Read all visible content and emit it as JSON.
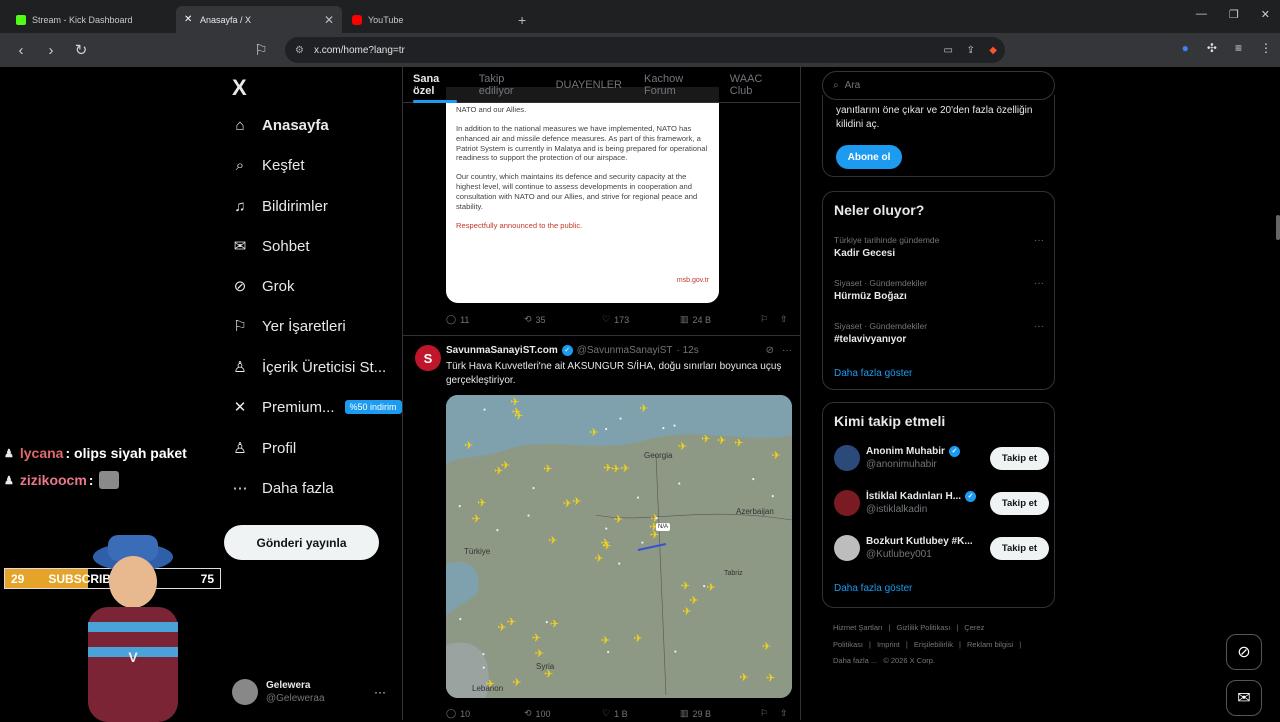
{
  "browser": {
    "tabs": [
      {
        "title": "Stream - Kick Dashboard",
        "favicon_color": "#53fc18"
      },
      {
        "title": "Anasayfa / X",
        "favicon_color": "#ffffff"
      },
      {
        "title": "YouTube",
        "favicon_color": "#ff0000"
      }
    ],
    "new_tab": "+",
    "url": "x.com/home?lang=tr"
  },
  "stream_overlay": {
    "chat": [
      {
        "user": "lycana",
        "user_color": "#e06a6a",
        "message": ": olips siyah paket"
      },
      {
        "user": "zizikoocm",
        "user_color": "#e8788a",
        "message": ":"
      }
    ],
    "subscribers": {
      "current": "29",
      "label": "SUBSCRIBERS",
      "goal": "75",
      "progress": 0.387
    }
  },
  "sidebar": {
    "logo": "X",
    "items": [
      {
        "label": "Anasayfa",
        "icon": "home-icon",
        "glyph": "⌂"
      },
      {
        "label": "Keşfet",
        "icon": "search-icon",
        "glyph": "⌕"
      },
      {
        "label": "Bildirimler",
        "icon": "bell-icon",
        "glyph": "♫"
      },
      {
        "label": "Sohbet",
        "icon": "mail-icon",
        "glyph": "✉"
      },
      {
        "label": "Grok",
        "icon": "grok-icon",
        "glyph": "⊘"
      },
      {
        "label": "Yer İşaretleri",
        "icon": "bookmark-icon",
        "glyph": "⚐"
      },
      {
        "label": "İçerik Üreticisi St...",
        "icon": "creator-icon",
        "glyph": "♙"
      },
      {
        "label": "Premium...",
        "icon": "x-icon",
        "glyph": "✕",
        "badge": "%50 indirim"
      },
      {
        "label": "Profil",
        "icon": "profile-icon",
        "glyph": "♙"
      },
      {
        "label": "Daha fazla",
        "icon": "more-icon",
        "glyph": "⋯"
      }
    ],
    "post_button": "Gönderi yayınla",
    "account": {
      "name": "Gelewera",
      "handle": "@Geleweraa",
      "more": "···"
    }
  },
  "timeline": {
    "tabs": [
      "Sana özel",
      "Takip ediliyor",
      "DUAYENLER",
      "Kachow Forum",
      "WAAC Club"
    ],
    "tweet1": {
      "doc_text": [
        "NATO and our Allies.",
        "In addition to the national measures we have implemented, NATO has enhanced air and missile defence measures. As part of this framework, a Patriot System is currently in Malatya and is being prepared for operational readiness to support the protection of our airspace.",
        "Our country, which maintains its defence and security capacity at the highest level, will continue to assess developments in cooperation and consultation with NATO and our Allies, and strive for regional peace and stability."
      ],
      "doc_closing": "Respectfully announced to the public.",
      "doc_site": "msb.gov.tr",
      "replies": "11",
      "reposts": "35",
      "likes": "173",
      "views": "24 B"
    },
    "tweet2": {
      "avatar_letter": "S",
      "name": "SavunmaSanayiST.com",
      "handle": "@SavunmaSanayiST",
      "time": "· 12s",
      "text": "Türk Hava Kuvvetleri'ne ait AKSUNGUR S/İHA, doğu sınırları boyunca uçuş gerçekleştiriyor.",
      "map_labels": [
        "Georgia",
        "Azerbaijan",
        "Türkiye",
        "Syria",
        "Lebanon",
        "Tabriz",
        "N/A"
      ],
      "replies": "10",
      "reposts": "100",
      "likes": "1 B",
      "views": "29 B"
    }
  },
  "right": {
    "search_placeholder": "Ara",
    "premium_text": "yanıtlarını öne çıkar ve 20'den fazla özelliğin kilidini aç.",
    "subscribe_button": "Abone ol",
    "trends_title": "Neler oluyor?",
    "trends": [
      {
        "context": "Türkiye tarihinde gündemde",
        "name": "Kadir Gecesi"
      },
      {
        "context": "Siyaset · Gündemdekiler",
        "name": "Hürmüz Boğazı"
      },
      {
        "context": "Siyaset · Gündemdekiler",
        "name": "#telavivyanıyor"
      }
    ],
    "show_more": "Daha fazla göster",
    "follow_title": "Kimi takip etmeli",
    "follows": [
      {
        "name": "Anonim Muhabir",
        "handle": "@anonimuhabir",
        "verified": true,
        "avatar_color": "#2b4a7a"
      },
      {
        "name": "İstiklal Kadınları H...",
        "handle": "@istiklalkadin",
        "verified": true,
        "avatar_color": "#7a1a22"
      },
      {
        "name": "Bozkurt Kutlubey #K...",
        "handle": "@Kutlubey001",
        "verified": false,
        "avatar_color": "#bdbdbd"
      }
    ],
    "follow_button": "Takip et",
    "footer": [
      "Hizmet Şartları",
      "|",
      "Gizlilik Politikası",
      "|",
      "Çerez Politikası",
      "|",
      "Imprint",
      "|",
      "Erişilebilirlik",
      "|",
      "Reklam bilgisi",
      "|",
      "Daha fazla ...",
      "© 2026 X Corp."
    ]
  }
}
